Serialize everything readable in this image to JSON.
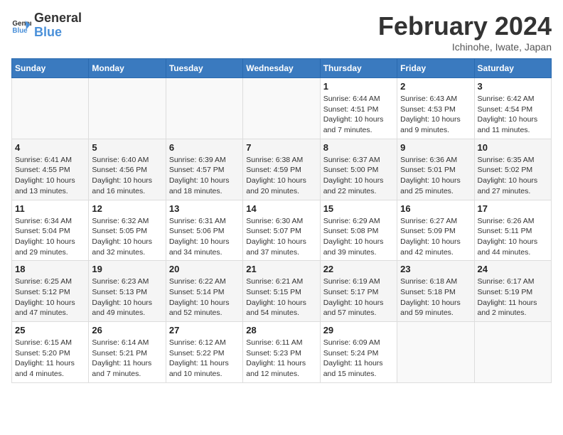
{
  "header": {
    "logo_general": "General",
    "logo_blue": "Blue",
    "month_year": "February 2024",
    "location": "Ichinohe, Iwate, Japan"
  },
  "weekdays": [
    "Sunday",
    "Monday",
    "Tuesday",
    "Wednesday",
    "Thursday",
    "Friday",
    "Saturday"
  ],
  "weeks": [
    [
      {
        "day": "",
        "info": ""
      },
      {
        "day": "",
        "info": ""
      },
      {
        "day": "",
        "info": ""
      },
      {
        "day": "",
        "info": ""
      },
      {
        "day": "1",
        "info": "Sunrise: 6:44 AM\nSunset: 4:51 PM\nDaylight: 10 hours\nand 7 minutes."
      },
      {
        "day": "2",
        "info": "Sunrise: 6:43 AM\nSunset: 4:53 PM\nDaylight: 10 hours\nand 9 minutes."
      },
      {
        "day": "3",
        "info": "Sunrise: 6:42 AM\nSunset: 4:54 PM\nDaylight: 10 hours\nand 11 minutes."
      }
    ],
    [
      {
        "day": "4",
        "info": "Sunrise: 6:41 AM\nSunset: 4:55 PM\nDaylight: 10 hours\nand 13 minutes."
      },
      {
        "day": "5",
        "info": "Sunrise: 6:40 AM\nSunset: 4:56 PM\nDaylight: 10 hours\nand 16 minutes."
      },
      {
        "day": "6",
        "info": "Sunrise: 6:39 AM\nSunset: 4:57 PM\nDaylight: 10 hours\nand 18 minutes."
      },
      {
        "day": "7",
        "info": "Sunrise: 6:38 AM\nSunset: 4:59 PM\nDaylight: 10 hours\nand 20 minutes."
      },
      {
        "day": "8",
        "info": "Sunrise: 6:37 AM\nSunset: 5:00 PM\nDaylight: 10 hours\nand 22 minutes."
      },
      {
        "day": "9",
        "info": "Sunrise: 6:36 AM\nSunset: 5:01 PM\nDaylight: 10 hours\nand 25 minutes."
      },
      {
        "day": "10",
        "info": "Sunrise: 6:35 AM\nSunset: 5:02 PM\nDaylight: 10 hours\nand 27 minutes."
      }
    ],
    [
      {
        "day": "11",
        "info": "Sunrise: 6:34 AM\nSunset: 5:04 PM\nDaylight: 10 hours\nand 29 minutes."
      },
      {
        "day": "12",
        "info": "Sunrise: 6:32 AM\nSunset: 5:05 PM\nDaylight: 10 hours\nand 32 minutes."
      },
      {
        "day": "13",
        "info": "Sunrise: 6:31 AM\nSunset: 5:06 PM\nDaylight: 10 hours\nand 34 minutes."
      },
      {
        "day": "14",
        "info": "Sunrise: 6:30 AM\nSunset: 5:07 PM\nDaylight: 10 hours\nand 37 minutes."
      },
      {
        "day": "15",
        "info": "Sunrise: 6:29 AM\nSunset: 5:08 PM\nDaylight: 10 hours\nand 39 minutes."
      },
      {
        "day": "16",
        "info": "Sunrise: 6:27 AM\nSunset: 5:09 PM\nDaylight: 10 hours\nand 42 minutes."
      },
      {
        "day": "17",
        "info": "Sunrise: 6:26 AM\nSunset: 5:11 PM\nDaylight: 10 hours\nand 44 minutes."
      }
    ],
    [
      {
        "day": "18",
        "info": "Sunrise: 6:25 AM\nSunset: 5:12 PM\nDaylight: 10 hours\nand 47 minutes."
      },
      {
        "day": "19",
        "info": "Sunrise: 6:23 AM\nSunset: 5:13 PM\nDaylight: 10 hours\nand 49 minutes."
      },
      {
        "day": "20",
        "info": "Sunrise: 6:22 AM\nSunset: 5:14 PM\nDaylight: 10 hours\nand 52 minutes."
      },
      {
        "day": "21",
        "info": "Sunrise: 6:21 AM\nSunset: 5:15 PM\nDaylight: 10 hours\nand 54 minutes."
      },
      {
        "day": "22",
        "info": "Sunrise: 6:19 AM\nSunset: 5:17 PM\nDaylight: 10 hours\nand 57 minutes."
      },
      {
        "day": "23",
        "info": "Sunrise: 6:18 AM\nSunset: 5:18 PM\nDaylight: 10 hours\nand 59 minutes."
      },
      {
        "day": "24",
        "info": "Sunrise: 6:17 AM\nSunset: 5:19 PM\nDaylight: 11 hours\nand 2 minutes."
      }
    ],
    [
      {
        "day": "25",
        "info": "Sunrise: 6:15 AM\nSunset: 5:20 PM\nDaylight: 11 hours\nand 4 minutes."
      },
      {
        "day": "26",
        "info": "Sunrise: 6:14 AM\nSunset: 5:21 PM\nDaylight: 11 hours\nand 7 minutes."
      },
      {
        "day": "27",
        "info": "Sunrise: 6:12 AM\nSunset: 5:22 PM\nDaylight: 11 hours\nand 10 minutes."
      },
      {
        "day": "28",
        "info": "Sunrise: 6:11 AM\nSunset: 5:23 PM\nDaylight: 11 hours\nand 12 minutes."
      },
      {
        "day": "29",
        "info": "Sunrise: 6:09 AM\nSunset: 5:24 PM\nDaylight: 11 hours\nand 15 minutes."
      },
      {
        "day": "",
        "info": ""
      },
      {
        "day": "",
        "info": ""
      }
    ]
  ]
}
